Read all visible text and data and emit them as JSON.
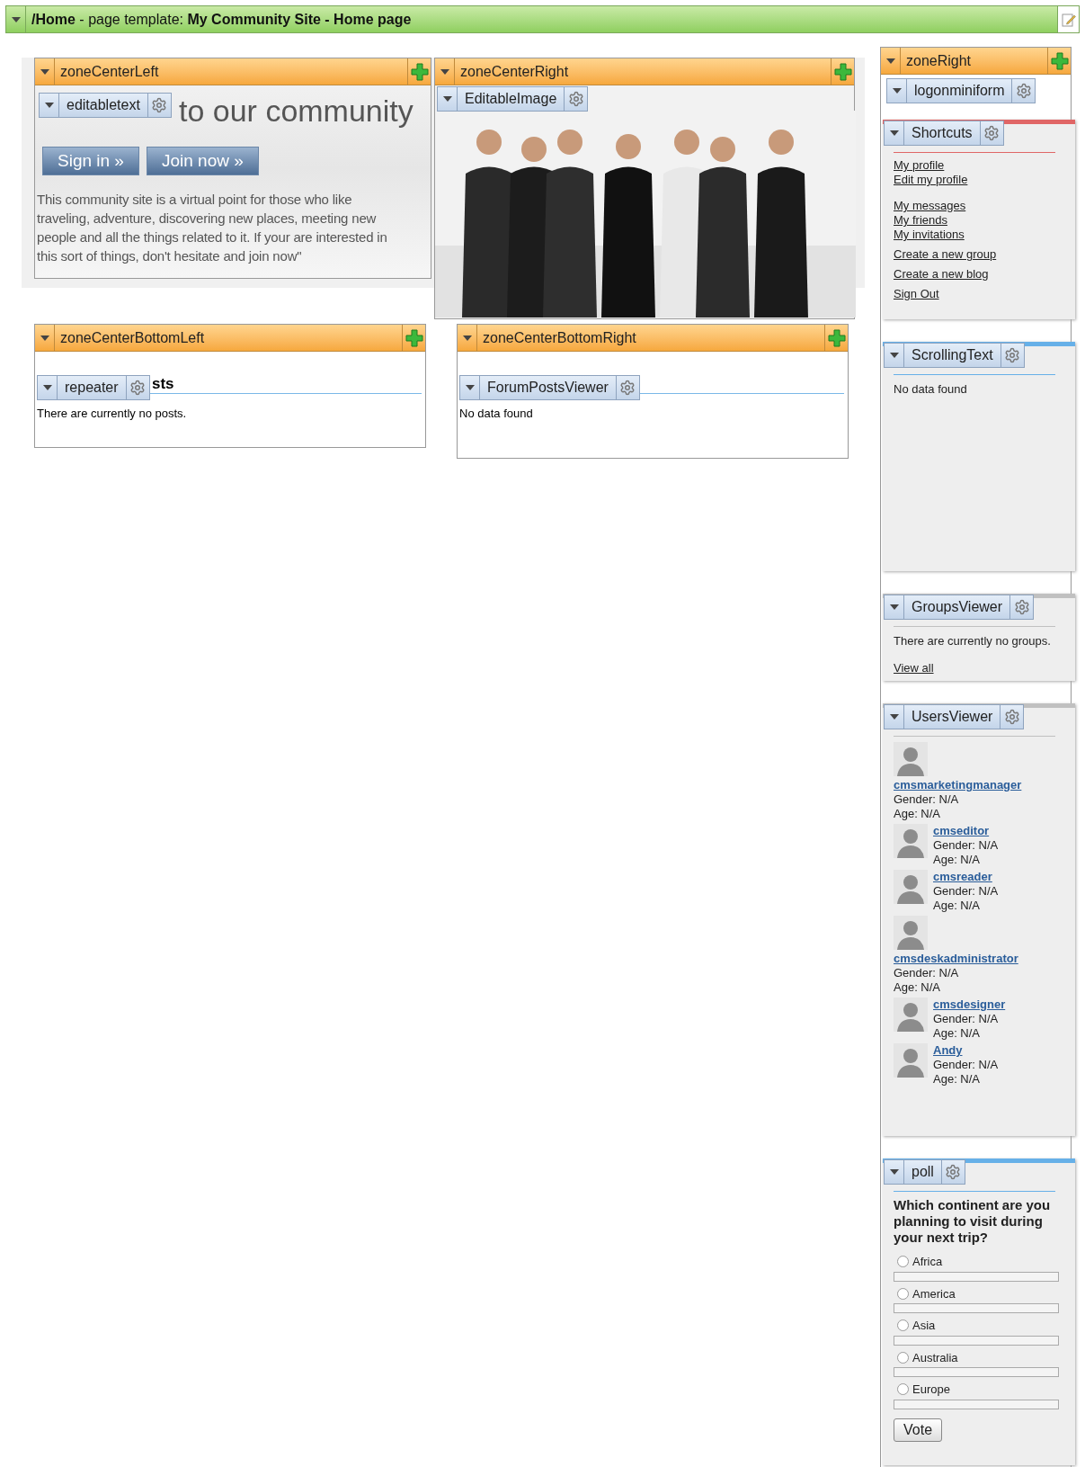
{
  "page_bar": {
    "title": "**/Home** - page template: **My Community Site - Home page**"
  },
  "zone_center_left": {
    "title": "zoneCenterLeft",
    "webpart": "editabletext",
    "heading": "to our community",
    "buttons": [
      "Sign in »",
      "Join now »"
    ],
    "text": "This community site is a virtual point for those who like traveling, adventure, discovering new places, meeting new people and all the things related to it. If your are interested in this sort of things, don't hesitate and join now\""
  },
  "zone_center_right": {
    "title": "zoneCenterRight",
    "webpart": "EditableImage"
  },
  "zone_center_bottom_left": {
    "title": "zoneCenterBottomLeft",
    "webpart": "repeater",
    "heading": "sts",
    "message": "There are currently no posts."
  },
  "zone_center_bottom_right": {
    "title": "zoneCenterBottomRight",
    "webpart": "ForumPostsViewer",
    "message": "No data found"
  },
  "zone_right": {
    "title": "zoneRight",
    "webparts": [
      {
        "kind": "plain",
        "title": "logonminiform"
      },
      {
        "kind": "links",
        "title": "Shortcuts",
        "color": "#e06666",
        "groups": [
          [
            "My profile",
            "Edit my profile"
          ],
          [
            "My messages",
            "My friends",
            "My invitations"
          ],
          [
            "Create a new group"
          ],
          [
            "Create a new blog"
          ],
          [
            "Sign Out"
          ]
        ]
      },
      {
        "kind": "message",
        "title": "ScrollingText",
        "color": "#66b0e8",
        "message": "No data found"
      },
      {
        "kind": "groups",
        "title": "GroupsViewer",
        "color": "#c0c0c0",
        "message": "There are currently no groups.",
        "link": "View all"
      },
      {
        "kind": "users",
        "title": "UsersViewer",
        "color": "#c0c0c0",
        "users": [
          {
            "name": "cmsmarketingmanager",
            "gender": "Gender: N/A",
            "age": "Age: N/A"
          },
          {
            "name": "cmseditor",
            "gender": "Gender: N/A",
            "age": "Age: N/A"
          },
          {
            "name": "cmsreader",
            "gender": "Gender: N/A",
            "age": "Age: N/A"
          },
          {
            "name": "cmsdeskadministrator",
            "gender": "Gender: N/A",
            "age": "Age: N/A"
          },
          {
            "name": "cmsdesigner",
            "gender": "Gender: N/A",
            "age": "Age: N/A"
          },
          {
            "name": "Andy",
            "gender": "Gender: N/A",
            "age": "Age: N/A"
          }
        ]
      },
      {
        "kind": "poll",
        "title": "poll",
        "color": "#66b0e8",
        "question": "Which continent are you planning to visit during your next trip?",
        "options": [
          {
            "label": "Africa",
            "selected": false,
            "level": 0
          },
          {
            "label": "America",
            "selected": false,
            "level": 0
          },
          {
            "label": "Asia",
            "selected": false,
            "level": 0
          },
          {
            "label": "Australia",
            "selected": false,
            "level": 0
          },
          {
            "label": "Europe",
            "selected": false,
            "level": 0
          }
        ],
        "button": "Vote"
      }
    ]
  }
}
